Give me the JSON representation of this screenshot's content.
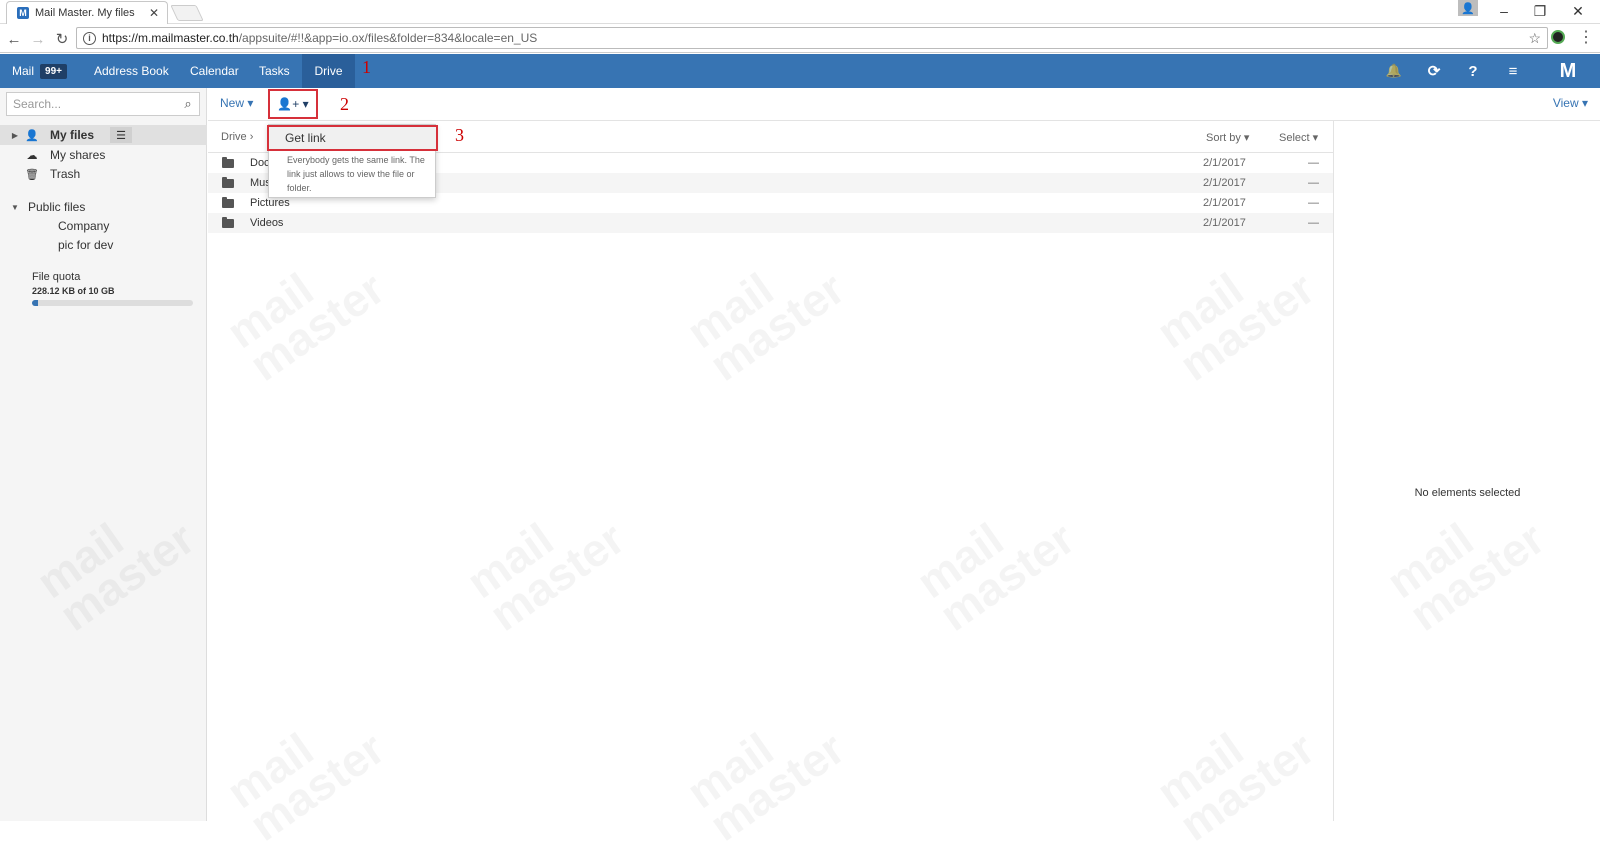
{
  "browser": {
    "tab_title": "Mail Master. My files",
    "tab_close": "✕",
    "url_host": "https://m.mailmaster.co.th",
    "url_path": "/appsuite/#!!&app=io.ox/files&folder=834&locale=en_US"
  },
  "topbar": {
    "mail_label": "Mail",
    "mail_badge": "99+",
    "nav": [
      "Address Book",
      "Calendar",
      "Tasks",
      "Drive"
    ],
    "active": "Drive",
    "bg_color": "#3774b3"
  },
  "annotations": {
    "one": "1",
    "two": "2",
    "three": "3",
    "color": "#d6303a"
  },
  "sidebar": {
    "search_placeholder": "Search...",
    "my_files": "My files",
    "my_shares": "My shares",
    "trash": "Trash",
    "public_files": "Public files",
    "company": "Company",
    "pic_for_dev": "pic for dev",
    "quota_label": "File quota",
    "quota_value": "228.12 KB of 10 GB",
    "quota_fraction": 0.04
  },
  "toolbar": {
    "new_label": "New ▾",
    "share_label": "👤+ ▾",
    "view_label": "View ▾"
  },
  "list": {
    "breadcrumb": "Drive ›",
    "sort_by": "Sort by ▾",
    "select": "Select ▾",
    "files": [
      {
        "name": "Documents",
        "visible_name": "Docu",
        "date": "2/1/2017",
        "size": "—"
      },
      {
        "name": "Music",
        "visible_name": "Mus",
        "date": "2/1/2017",
        "size": "—"
      },
      {
        "name": "Pictures",
        "visible_name": "Pictures",
        "date": "2/1/2017",
        "size": "—"
      },
      {
        "name": "Videos",
        "visible_name": "Videos",
        "date": "2/1/2017",
        "size": "—"
      }
    ]
  },
  "dropdown": {
    "get_link": "Get link",
    "description": "Everybody gets the same link. The link just allows to view the file or folder."
  },
  "right_panel": {
    "empty_text": "No elements selected"
  }
}
